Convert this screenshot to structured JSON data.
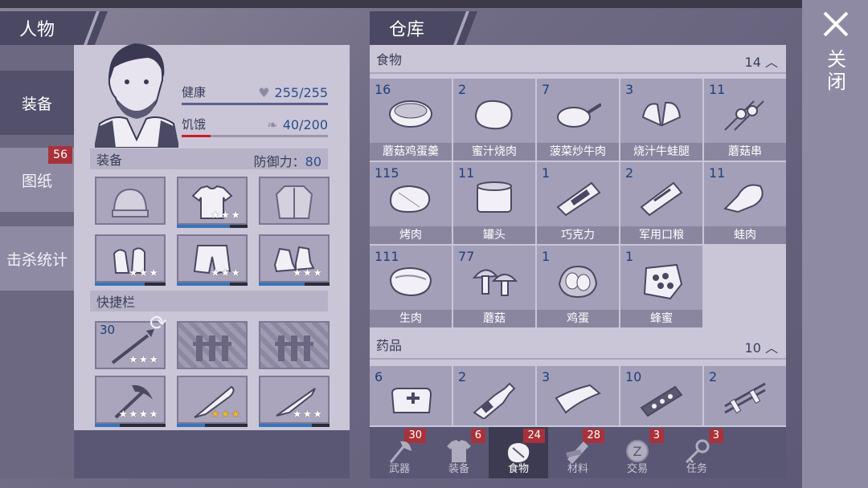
{
  "character": {
    "header": "人物",
    "tabs": [
      {
        "label": "装备",
        "active": true
      },
      {
        "label": "图纸",
        "badge": "56"
      },
      {
        "label": "击杀统计"
      }
    ],
    "health": {
      "label": "健康",
      "value": "255/255",
      "fraction": 1.0
    },
    "hunger": {
      "label": "饥饿",
      "value": "40/200",
      "fraction": 0.2
    },
    "equipment": {
      "label": "装备",
      "defense_label": "防御力：",
      "defense_value": "80"
    },
    "equip_slots": [
      {
        "icon": "beanie-icon",
        "stars": "",
        "durability": 0
      },
      {
        "icon": "tshirt-icon",
        "stars": "★★★",
        "durability": 0.75
      },
      {
        "icon": "jacket-icon",
        "stars": "",
        "durability": 0
      },
      {
        "icon": "gloves-icon",
        "stars": "★★★",
        "durability": 0.7
      },
      {
        "icon": "shorts-icon",
        "stars": "★★★",
        "durability": 0.75
      },
      {
        "icon": "shoes-icon",
        "stars": "★★★",
        "durability": 0.65
      }
    ],
    "quickbar": {
      "label": "快捷栏"
    },
    "quick_slots": [
      {
        "icon": "spear-icon",
        "count": "30",
        "stars": "★★★",
        "locked": false
      },
      {
        "icon": "lock-fence-icon",
        "locked": true
      },
      {
        "icon": "lock-fence-icon",
        "locked": true
      },
      {
        "icon": "pickaxe-icon",
        "stars": "★★★★",
        "durability": 0.35
      },
      {
        "icon": "machete-icon",
        "stars": "★★★",
        "gold": true,
        "durability": 0.4
      },
      {
        "icon": "knife-icon",
        "stars": "★★★",
        "durability": 0.75
      }
    ]
  },
  "warehouse": {
    "header": "仓库",
    "food": {
      "label": "食物",
      "count": "14",
      "items": [
        {
          "count": "16",
          "name": "蘑菇鸡蛋羹"
        },
        {
          "count": "2",
          "name": "蜜汁烧肉"
        },
        {
          "count": "7",
          "name": "菠菜炒牛肉"
        },
        {
          "count": "3",
          "name": "烧汁牛蛙腿"
        },
        {
          "count": "11",
          "name": "蘑菇串"
        },
        {
          "count": "115",
          "name": "烤肉"
        },
        {
          "count": "11",
          "name": "罐头"
        },
        {
          "count": "1",
          "name": "巧克力"
        },
        {
          "count": "2",
          "name": "军用口粮"
        },
        {
          "count": "11",
          "name": "蛙肉"
        },
        {
          "count": "111",
          "name": "生肉"
        },
        {
          "count": "77",
          "name": "蘑菇"
        },
        {
          "count": "1",
          "name": "鸡蛋"
        },
        {
          "count": "1",
          "name": "蜂蜜"
        }
      ]
    },
    "medicine": {
      "label": "药品",
      "count": "10",
      "items": [
        {
          "count": "6",
          "icon": "first-aid-bag-icon"
        },
        {
          "count": "2",
          "icon": "bottle-icon"
        },
        {
          "count": "3",
          "icon": "bandage-icon"
        },
        {
          "count": "10",
          "icon": "pill-strip-icon"
        },
        {
          "count": "2",
          "icon": "splint-icon"
        }
      ]
    },
    "bottom_tabs": [
      {
        "label": "武器",
        "badge": "30",
        "icon": "axe-icon"
      },
      {
        "label": "装备",
        "badge": "6",
        "icon": "shirt-icon"
      },
      {
        "label": "食物",
        "badge": "24",
        "icon": "meat-icon",
        "active": true
      },
      {
        "label": "材料",
        "badge": "28",
        "icon": "wood-icon"
      },
      {
        "label": "交易",
        "badge": "3",
        "icon": "coin-icon"
      },
      {
        "label": "任务",
        "badge": "3",
        "icon": "key-icon"
      }
    ]
  },
  "close": {
    "label": "关闭"
  },
  "colors": {
    "health_bar": "#5a5f8e",
    "hunger_bar": "#c81e28",
    "badge": "#a8323a",
    "count_text": "#1f3f7a"
  }
}
